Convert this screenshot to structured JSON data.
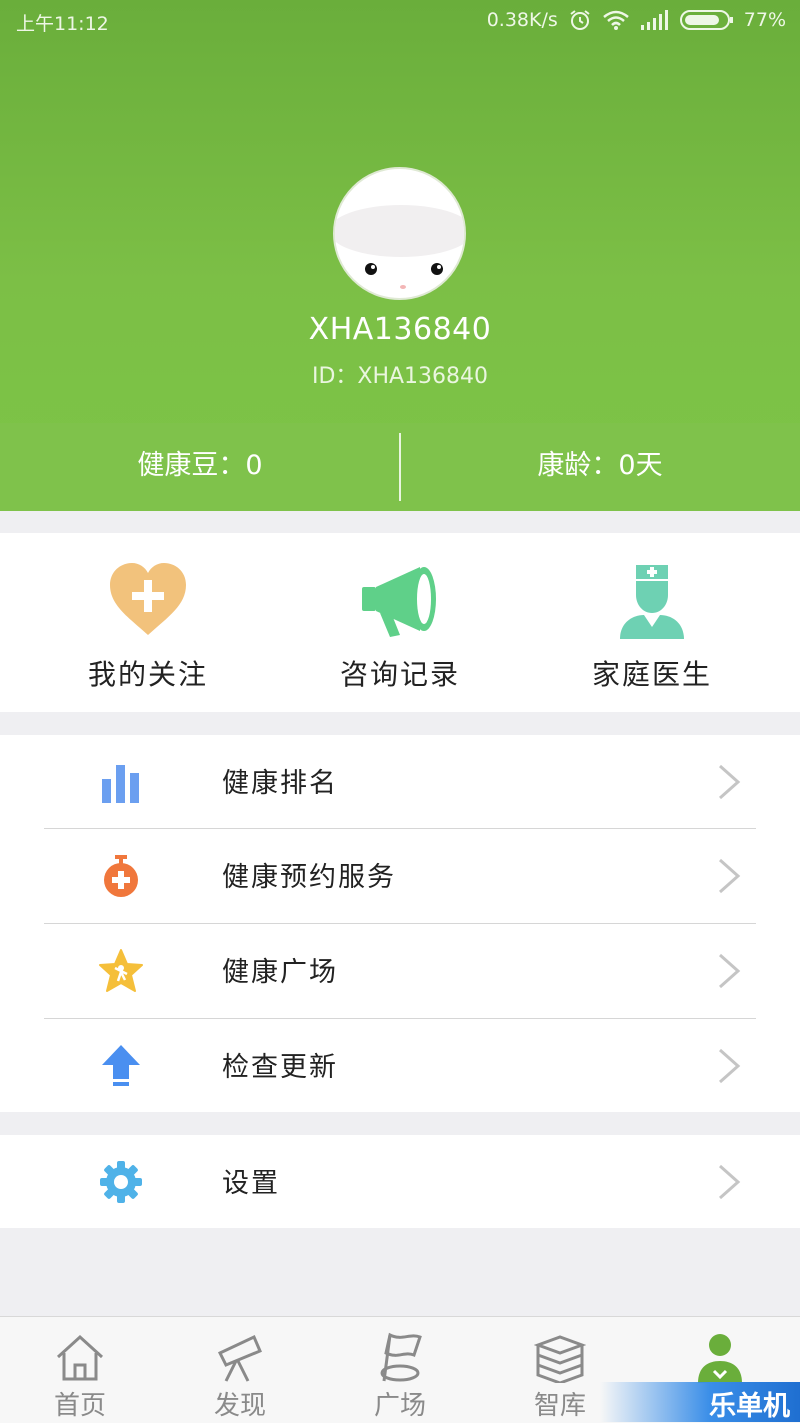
{
  "status_bar": {
    "time": "上午11:12",
    "network_speed": "0.38K/s",
    "battery": "77%"
  },
  "profile": {
    "username": "XHA136840",
    "id_text": "ID：XHA136840"
  },
  "stats": {
    "health_beans": "健康豆：0",
    "health_age": "康龄：0天"
  },
  "quick_actions": [
    {
      "label": "我的关注",
      "icon": "heart-plus-icon"
    },
    {
      "label": "咨询记录",
      "icon": "megaphone-icon"
    },
    {
      "label": "家庭医生",
      "icon": "nurse-icon"
    }
  ],
  "menu": [
    {
      "label": "健康排名",
      "icon": "bar-chart-icon"
    },
    {
      "label": "健康预约服务",
      "icon": "stopwatch-plus-icon"
    },
    {
      "label": "健康广场",
      "icon": "star-icon"
    },
    {
      "label": "检查更新",
      "icon": "upload-arrow-icon"
    }
  ],
  "settings": {
    "label": "设置",
    "icon": "gear-icon"
  },
  "bottom_nav": [
    {
      "label": "首页",
      "icon": "home-icon"
    },
    {
      "label": "发现",
      "icon": "telescope-icon"
    },
    {
      "label": "广场",
      "icon": "flag-icon"
    },
    {
      "label": "智库",
      "icon": "books-icon"
    },
    {
      "label": "",
      "icon": "person-icon",
      "active": true
    }
  ],
  "watermark": "乐单机",
  "colors": {
    "header_green": "#6aae3b",
    "stats_green": "#7fc24b",
    "active_tab": "#6aae3b"
  }
}
